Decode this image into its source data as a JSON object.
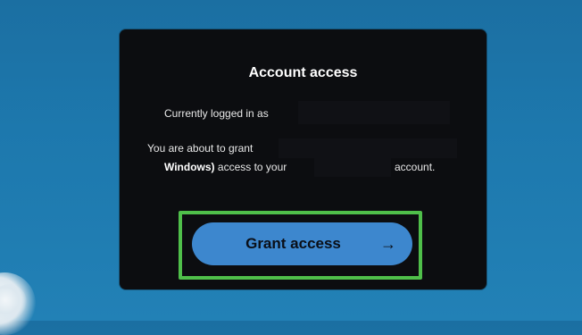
{
  "dialog": {
    "title": "Account access",
    "logged_in_text": "Currently logged in as",
    "grant_text": "You are about to grant",
    "app_name": "Windows)",
    "access_text": "access to your",
    "account_text": "account."
  },
  "grant_button": {
    "label": "Grant access",
    "icon": "arrow-right-icon",
    "arrow_glyph": "→"
  },
  "colors": {
    "background": "#1d78ad",
    "dialog": "#0c0d10",
    "button": "#3d87ce",
    "highlight": "#4fbf4a"
  }
}
